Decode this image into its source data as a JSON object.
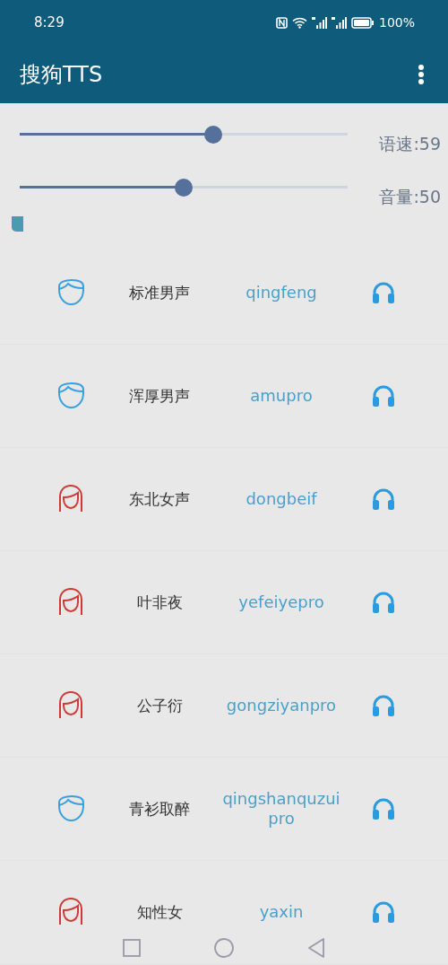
{
  "status_bar": {
    "time": "8:29",
    "battery": "100%"
  },
  "app_bar": {
    "title": "搜狗TTS"
  },
  "sliders": [
    {
      "label": "语速:59",
      "level": 0.59
    },
    {
      "label": "音量:50",
      "level": 0.5
    }
  ],
  "voices": [
    {
      "kind": "male",
      "name": "标准男声",
      "id": "qingfeng"
    },
    {
      "kind": "male",
      "name": "浑厚男声",
      "id": "amupro"
    },
    {
      "kind": "female",
      "name": "东北女声",
      "id": "dongbeif"
    },
    {
      "kind": "female",
      "name": "叶非夜",
      "id": "yefeiyepro"
    },
    {
      "kind": "female",
      "name": "公子衍",
      "id": "gongziyanpro"
    },
    {
      "kind": "male",
      "name": "青衫取醉",
      "id": "qingshanquzui pro"
    },
    {
      "kind": "female",
      "name": "知性女",
      "id": "yaxin"
    }
  ]
}
